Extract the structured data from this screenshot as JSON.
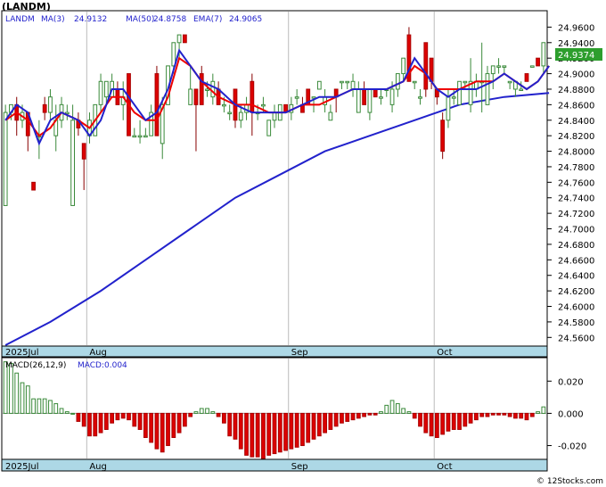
{
  "title": "(LANDM)",
  "watermark": "© 12Stocks.com",
  "legend": {
    "ticker": "LANDM",
    "ma3": "MA(3)",
    "ma3_value": "24.9132",
    "ma50": "MA(50)",
    "ma50_value": "24.8758",
    "ema7": "EMA(7)",
    "ema7_value": "24.9065"
  },
  "macd_legend": {
    "label": "MACD(26,12,9)",
    "value_text": "MACD:0.004"
  },
  "last_price": "24.9374",
  "colors": {
    "up": "#3a8a3a",
    "down": "#dd0000",
    "ma": "#2222cc",
    "ema": "#ee0000",
    "axis_band": "#add8e6",
    "label_box": "#2d9e2d",
    "grid": "#bbbbbb"
  },
  "chart_data": [
    {
      "type": "candlestick",
      "name": "price",
      "ylim": [
        24.55,
        24.98
      ],
      "yticks": [
        "24.9600",
        "24.9400",
        "24.9200",
        "24.9000",
        "24.8800",
        "24.8600",
        "24.8400",
        "24.8200",
        "24.8000",
        "24.7800",
        "24.7600",
        "24.7400",
        "24.7200",
        "24.7000",
        "24.6800",
        "24.6600",
        "24.6400",
        "24.6200",
        "24.6000",
        "24.5800",
        "24.5600"
      ],
      "x_labels": [
        {
          "label": "2025Jul",
          "index": 0
        },
        {
          "label": "Aug",
          "index": 15
        },
        {
          "label": "Sep",
          "index": 51
        },
        {
          "label": "Oct",
          "index": 77
        }
      ],
      "candles": [
        {
          "o": 24.73,
          "h": 24.86,
          "l": 24.73,
          "c": 24.85
        },
        {
          "o": 24.85,
          "h": 24.86,
          "l": 24.84,
          "c": 24.86
        },
        {
          "o": 24.86,
          "h": 24.87,
          "l": 24.82,
          "c": 24.84
        },
        {
          "o": 24.84,
          "h": 24.86,
          "l": 24.83,
          "c": 24.85
        },
        {
          "o": 24.85,
          "h": 24.85,
          "l": 24.8,
          "c": 24.82
        },
        {
          "o": 24.76,
          "h": 24.76,
          "l": 24.75,
          "c": 24.75
        },
        {
          "o": 24.82,
          "h": 24.84,
          "l": 24.79,
          "c": 24.82
        },
        {
          "o": 24.86,
          "h": 24.87,
          "l": 24.84,
          "c": 24.85
        },
        {
          "o": 24.85,
          "h": 24.88,
          "l": 24.84,
          "c": 24.87
        },
        {
          "o": 24.82,
          "h": 24.86,
          "l": 24.8,
          "c": 24.84
        },
        {
          "o": 24.84,
          "h": 24.87,
          "l": 24.83,
          "c": 24.86
        },
        {
          "o": 24.85,
          "h": 24.86,
          "l": 24.84,
          "c": 24.85
        },
        {
          "o": 24.73,
          "h": 24.86,
          "l": 24.73,
          "c": 24.84
        },
        {
          "o": 24.84,
          "h": 24.85,
          "l": 24.82,
          "c": 24.83
        },
        {
          "o": 24.81,
          "h": 24.81,
          "l": 24.75,
          "c": 24.79
        },
        {
          "o": 24.82,
          "h": 24.85,
          "l": 24.81,
          "c": 24.84
        },
        {
          "o": 24.82,
          "h": 24.86,
          "l": 24.82,
          "c": 24.86
        },
        {
          "o": 24.86,
          "h": 24.9,
          "l": 24.85,
          "c": 24.89
        },
        {
          "o": 24.87,
          "h": 24.89,
          "l": 24.86,
          "c": 24.89
        },
        {
          "o": 24.87,
          "h": 24.9,
          "l": 24.87,
          "c": 24.89
        },
        {
          "o": 24.88,
          "h": 24.89,
          "l": 24.86,
          "c": 24.86
        },
        {
          "o": 24.86,
          "h": 24.89,
          "l": 24.84,
          "c": 24.87
        },
        {
          "o": 24.9,
          "h": 24.9,
          "l": 24.82,
          "c": 24.82
        },
        {
          "o": 24.82,
          "h": 24.83,
          "l": 24.82,
          "c": 24.82
        },
        {
          "o": 24.82,
          "h": 24.84,
          "l": 24.81,
          "c": 24.82
        },
        {
          "o": 24.82,
          "h": 24.83,
          "l": 24.82,
          "c": 24.82
        },
        {
          "o": 24.82,
          "h": 24.86,
          "l": 24.82,
          "c": 24.85
        },
        {
          "o": 24.9,
          "h": 24.91,
          "l": 24.82,
          "c": 24.82
        },
        {
          "o": 24.81,
          "h": 24.87,
          "l": 24.79,
          "c": 24.86
        },
        {
          "o": 24.86,
          "h": 24.91,
          "l": 24.86,
          "c": 24.91
        },
        {
          "o": 24.91,
          "h": 24.94,
          "l": 24.9,
          "c": 24.94
        },
        {
          "o": 24.94,
          "h": 24.95,
          "l": 24.92,
          "c": 24.95
        },
        {
          "o": 24.95,
          "h": 24.95,
          "l": 24.94,
          "c": 24.94
        },
        {
          "o": 24.86,
          "h": 24.91,
          "l": 24.86,
          "c": 24.88
        },
        {
          "o": 24.88,
          "h": 24.88,
          "l": 24.8,
          "c": 24.86
        },
        {
          "o": 24.9,
          "h": 24.91,
          "l": 24.86,
          "c": 24.86
        },
        {
          "o": 24.88,
          "h": 24.89,
          "l": 24.87,
          "c": 24.88
        },
        {
          "o": 24.87,
          "h": 24.9,
          "l": 24.86,
          "c": 24.89
        },
        {
          "o": 24.88,
          "h": 24.89,
          "l": 24.86,
          "c": 24.86
        },
        {
          "o": 24.86,
          "h": 24.87,
          "l": 24.85,
          "c": 24.86
        },
        {
          "o": 24.85,
          "h": 24.86,
          "l": 24.84,
          "c": 24.85
        },
        {
          "o": 24.88,
          "h": 24.88,
          "l": 24.83,
          "c": 24.84
        },
        {
          "o": 24.84,
          "h": 24.86,
          "l": 24.83,
          "c": 24.85
        },
        {
          "o": 24.85,
          "h": 24.87,
          "l": 24.84,
          "c": 24.86
        },
        {
          "o": 24.89,
          "h": 24.9,
          "l": 24.82,
          "c": 24.85
        },
        {
          "o": 24.85,
          "h": 24.86,
          "l": 24.84,
          "c": 24.85
        },
        {
          "o": 24.86,
          "h": 24.87,
          "l": 24.85,
          "c": 24.86
        },
        {
          "o": 24.82,
          "h": 24.84,
          "l": 24.82,
          "c": 24.84
        },
        {
          "o": 24.84,
          "h": 24.86,
          "l": 24.83,
          "c": 24.85
        },
        {
          "o": 24.84,
          "h": 24.86,
          "l": 24.84,
          "c": 24.86
        },
        {
          "o": 24.86,
          "h": 24.86,
          "l": 24.85,
          "c": 24.85
        },
        {
          "o": 24.85,
          "h": 24.87,
          "l": 24.84,
          "c": 24.86
        },
        {
          "o": 24.87,
          "h": 24.88,
          "l": 24.86,
          "c": 24.87
        },
        {
          "o": 24.86,
          "h": 24.87,
          "l": 24.85,
          "c": 24.85
        },
        {
          "o": 24.88,
          "h": 24.88,
          "l": 24.86,
          "c": 24.86
        },
        {
          "o": 24.87,
          "h": 24.87,
          "l": 24.85,
          "c": 24.87
        },
        {
          "o": 24.88,
          "h": 24.89,
          "l": 24.88,
          "c": 24.89
        },
        {
          "o": 24.86,
          "h": 24.88,
          "l": 24.85,
          "c": 24.87
        },
        {
          "o": 24.84,
          "h": 24.86,
          "l": 24.84,
          "c": 24.85
        },
        {
          "o": 24.88,
          "h": 24.88,
          "l": 24.85,
          "c": 24.87
        },
        {
          "o": 24.89,
          "h": 24.89,
          "l": 24.88,
          "c": 24.89
        },
        {
          "o": 24.89,
          "h": 24.89,
          "l": 24.88,
          "c": 24.89
        },
        {
          "o": 24.88,
          "h": 24.9,
          "l": 24.87,
          "c": 24.89
        },
        {
          "o": 24.85,
          "h": 24.89,
          "l": 24.85,
          "c": 24.88
        },
        {
          "o": 24.88,
          "h": 24.89,
          "l": 24.86,
          "c": 24.86
        },
        {
          "o": 24.85,
          "h": 24.88,
          "l": 24.84,
          "c": 24.88
        },
        {
          "o": 24.88,
          "h": 24.88,
          "l": 24.87,
          "c": 24.87
        },
        {
          "o": 24.87,
          "h": 24.88,
          "l": 24.86,
          "c": 24.87
        },
        {
          "o": 24.88,
          "h": 24.88,
          "l": 24.87,
          "c": 24.88
        },
        {
          "o": 24.86,
          "h": 24.89,
          "l": 24.85,
          "c": 24.88
        },
        {
          "o": 24.88,
          "h": 24.9,
          "l": 24.87,
          "c": 24.9
        },
        {
          "o": 24.9,
          "h": 24.92,
          "l": 24.89,
          "c": 24.92
        },
        {
          "o": 24.95,
          "h": 24.96,
          "l": 24.89,
          "c": 24.89
        },
        {
          "o": 24.89,
          "h": 24.89,
          "l": 24.88,
          "c": 24.89
        },
        {
          "o": 24.87,
          "h": 24.88,
          "l": 24.86,
          "c": 24.87
        },
        {
          "o": 24.94,
          "h": 24.94,
          "l": 24.87,
          "c": 24.88
        },
        {
          "o": 24.92,
          "h": 24.92,
          "l": 24.88,
          "c": 24.89
        },
        {
          "o": 24.88,
          "h": 24.88,
          "l": 24.86,
          "c": 24.87
        },
        {
          "o": 24.84,
          "h": 24.85,
          "l": 24.79,
          "c": 24.8
        },
        {
          "o": 24.84,
          "h": 24.88,
          "l": 24.83,
          "c": 24.87
        },
        {
          "o": 24.87,
          "h": 24.88,
          "l": 24.86,
          "c": 24.87
        },
        {
          "o": 24.86,
          "h": 24.89,
          "l": 24.86,
          "c": 24.89
        },
        {
          "o": 24.89,
          "h": 24.89,
          "l": 24.88,
          "c": 24.89
        },
        {
          "o": 24.86,
          "h": 24.92,
          "l": 24.85,
          "c": 24.89
        },
        {
          "o": 24.88,
          "h": 24.9,
          "l": 24.87,
          "c": 24.89
        },
        {
          "o": 24.89,
          "h": 24.94,
          "l": 24.85,
          "c": 24.89
        },
        {
          "o": 24.86,
          "h": 24.91,
          "l": 24.86,
          "c": 24.9
        },
        {
          "o": 24.9,
          "h": 24.91,
          "l": 24.88,
          "c": 24.91
        },
        {
          "o": 24.91,
          "h": 24.92,
          "l": 24.9,
          "c": 24.91
        },
        {
          "o": 24.91,
          "h": 24.91,
          "l": 24.9,
          "c": 24.91
        },
        {
          "o": 24.89,
          "h": 24.89,
          "l": 24.88,
          "c": 24.89
        },
        {
          "o": 24.88,
          "h": 24.89,
          "l": 24.87,
          "c": 24.89
        },
        {
          "o": 24.88,
          "h": 24.89,
          "l": 24.88,
          "c": 24.88
        },
        {
          "o": 24.9,
          "h": 24.9,
          "l": 24.89,
          "c": 24.89
        },
        {
          "o": 24.91,
          "h": 24.91,
          "l": 24.91,
          "c": 24.91
        },
        {
          "o": 24.92,
          "h": 24.92,
          "l": 24.91,
          "c": 24.91
        },
        {
          "o": 24.91,
          "h": 24.94,
          "l": 24.9,
          "c": 24.94
        }
      ],
      "ma50": {
        "name": "MA(50)",
        "points": [
          [
            0,
            24.55
          ],
          [
            8,
            24.58
          ],
          [
            17,
            24.62
          ],
          [
            25,
            24.66
          ],
          [
            33,
            24.7
          ],
          [
            41,
            24.74
          ],
          [
            49,
            24.77
          ],
          [
            57,
            24.8
          ],
          [
            65,
            24.82
          ],
          [
            73,
            24.84
          ],
          [
            81,
            24.86
          ],
          [
            89,
            24.87
          ],
          [
            97,
            24.875
          ]
        ]
      },
      "ma3": {
        "name": "MA(3)",
        "points": [
          [
            0,
            24.84
          ],
          [
            2,
            24.86
          ],
          [
            4,
            24.85
          ],
          [
            6,
            24.81
          ],
          [
            8,
            24.84
          ],
          [
            10,
            24.85
          ],
          [
            13,
            24.84
          ],
          [
            15,
            24.82
          ],
          [
            17,
            24.84
          ],
          [
            19,
            24.88
          ],
          [
            21,
            24.88
          ],
          [
            23,
            24.86
          ],
          [
            25,
            24.84
          ],
          [
            27,
            24.85
          ],
          [
            29,
            24.88
          ],
          [
            31,
            24.93
          ],
          [
            33,
            24.91
          ],
          [
            35,
            24.89
          ],
          [
            38,
            24.88
          ],
          [
            41,
            24.86
          ],
          [
            44,
            24.85
          ],
          [
            47,
            24.85
          ],
          [
            50,
            24.85
          ],
          [
            53,
            24.86
          ],
          [
            56,
            24.87
          ],
          [
            59,
            24.87
          ],
          [
            62,
            24.88
          ],
          [
            65,
            24.88
          ],
          [
            68,
            24.88
          ],
          [
            71,
            24.89
          ],
          [
            73,
            24.92
          ],
          [
            75,
            24.9
          ],
          [
            77,
            24.88
          ],
          [
            79,
            24.87
          ],
          [
            81,
            24.88
          ],
          [
            84,
            24.88
          ],
          [
            87,
            24.89
          ],
          [
            89,
            24.9
          ],
          [
            91,
            24.89
          ],
          [
            93,
            24.88
          ],
          [
            95,
            24.89
          ],
          [
            97,
            24.91
          ]
        ]
      },
      "ema7": {
        "name": "EMA(7)",
        "points": [
          [
            0,
            24.84
          ],
          [
            2,
            24.85
          ],
          [
            4,
            24.84
          ],
          [
            6,
            24.82
          ],
          [
            8,
            24.83
          ],
          [
            10,
            24.85
          ],
          [
            13,
            24.84
          ],
          [
            15,
            24.83
          ],
          [
            17,
            24.85
          ],
          [
            19,
            24.87
          ],
          [
            21,
            24.87
          ],
          [
            23,
            24.85
          ],
          [
            25,
            24.84
          ],
          [
            27,
            24.84
          ],
          [
            29,
            24.87
          ],
          [
            31,
            24.92
          ],
          [
            33,
            24.91
          ],
          [
            35,
            24.89
          ],
          [
            38,
            24.87
          ],
          [
            41,
            24.86
          ],
          [
            44,
            24.86
          ],
          [
            47,
            24.85
          ],
          [
            50,
            24.85
          ],
          [
            53,
            24.86
          ],
          [
            56,
            24.86
          ],
          [
            59,
            24.87
          ],
          [
            62,
            24.88
          ],
          [
            65,
            24.88
          ],
          [
            68,
            24.88
          ],
          [
            71,
            24.89
          ],
          [
            73,
            24.91
          ],
          [
            75,
            24.9
          ],
          [
            77,
            24.88
          ],
          [
            79,
            24.88
          ],
          [
            81,
            24.88
          ],
          [
            84,
            24.89
          ],
          [
            87,
            24.89
          ],
          [
            89,
            24.9
          ],
          [
            91,
            24.89
          ],
          [
            93,
            24.88
          ],
          [
            95,
            24.89
          ],
          [
            97,
            24.91
          ]
        ]
      }
    },
    {
      "type": "bar",
      "name": "MACD(26,12,9)",
      "ylim": [
        -0.028,
        0.034
      ],
      "yticks": [
        "0.020",
        "0.000",
        "-0.020"
      ],
      "x_labels": [
        {
          "label": "2025Jul",
          "index": 0
        },
        {
          "label": "Aug",
          "index": 15
        },
        {
          "label": "Sep",
          "index": 51
        },
        {
          "label": "Oct",
          "index": 77
        }
      ],
      "values": [
        0.032,
        0.031,
        0.025,
        0.019,
        0.017,
        0.009,
        0.009,
        0.009,
        0.008,
        0.006,
        0.003,
        0.001,
        0.0,
        -0.005,
        -0.008,
        -0.014,
        -0.014,
        -0.012,
        -0.01,
        -0.006,
        -0.004,
        -0.003,
        -0.004,
        -0.008,
        -0.01,
        -0.015,
        -0.018,
        -0.022,
        -0.024,
        -0.02,
        -0.015,
        -0.012,
        -0.008,
        -0.002,
        0.001,
        0.003,
        0.003,
        0.001,
        -0.002,
        -0.006,
        -0.014,
        -0.016,
        -0.022,
        -0.026,
        -0.027,
        -0.027,
        -0.028,
        -0.026,
        -0.025,
        -0.024,
        -0.023,
        -0.022,
        -0.021,
        -0.02,
        -0.018,
        -0.016,
        -0.014,
        -0.012,
        -0.01,
        -0.008,
        -0.006,
        -0.005,
        -0.004,
        -0.003,
        -0.002,
        -0.001,
        -0.001,
        0.001,
        0.005,
        0.008,
        0.006,
        0.003,
        0.001,
        -0.003,
        -0.008,
        -0.012,
        -0.014,
        -0.015,
        -0.013,
        -0.011,
        -0.01,
        -0.01,
        -0.008,
        -0.006,
        -0.004,
        -0.002,
        -0.002,
        -0.001,
        -0.001,
        -0.001,
        -0.002,
        -0.003,
        -0.003,
        -0.004,
        -0.002,
        0.001,
        0.004
      ]
    }
  ]
}
